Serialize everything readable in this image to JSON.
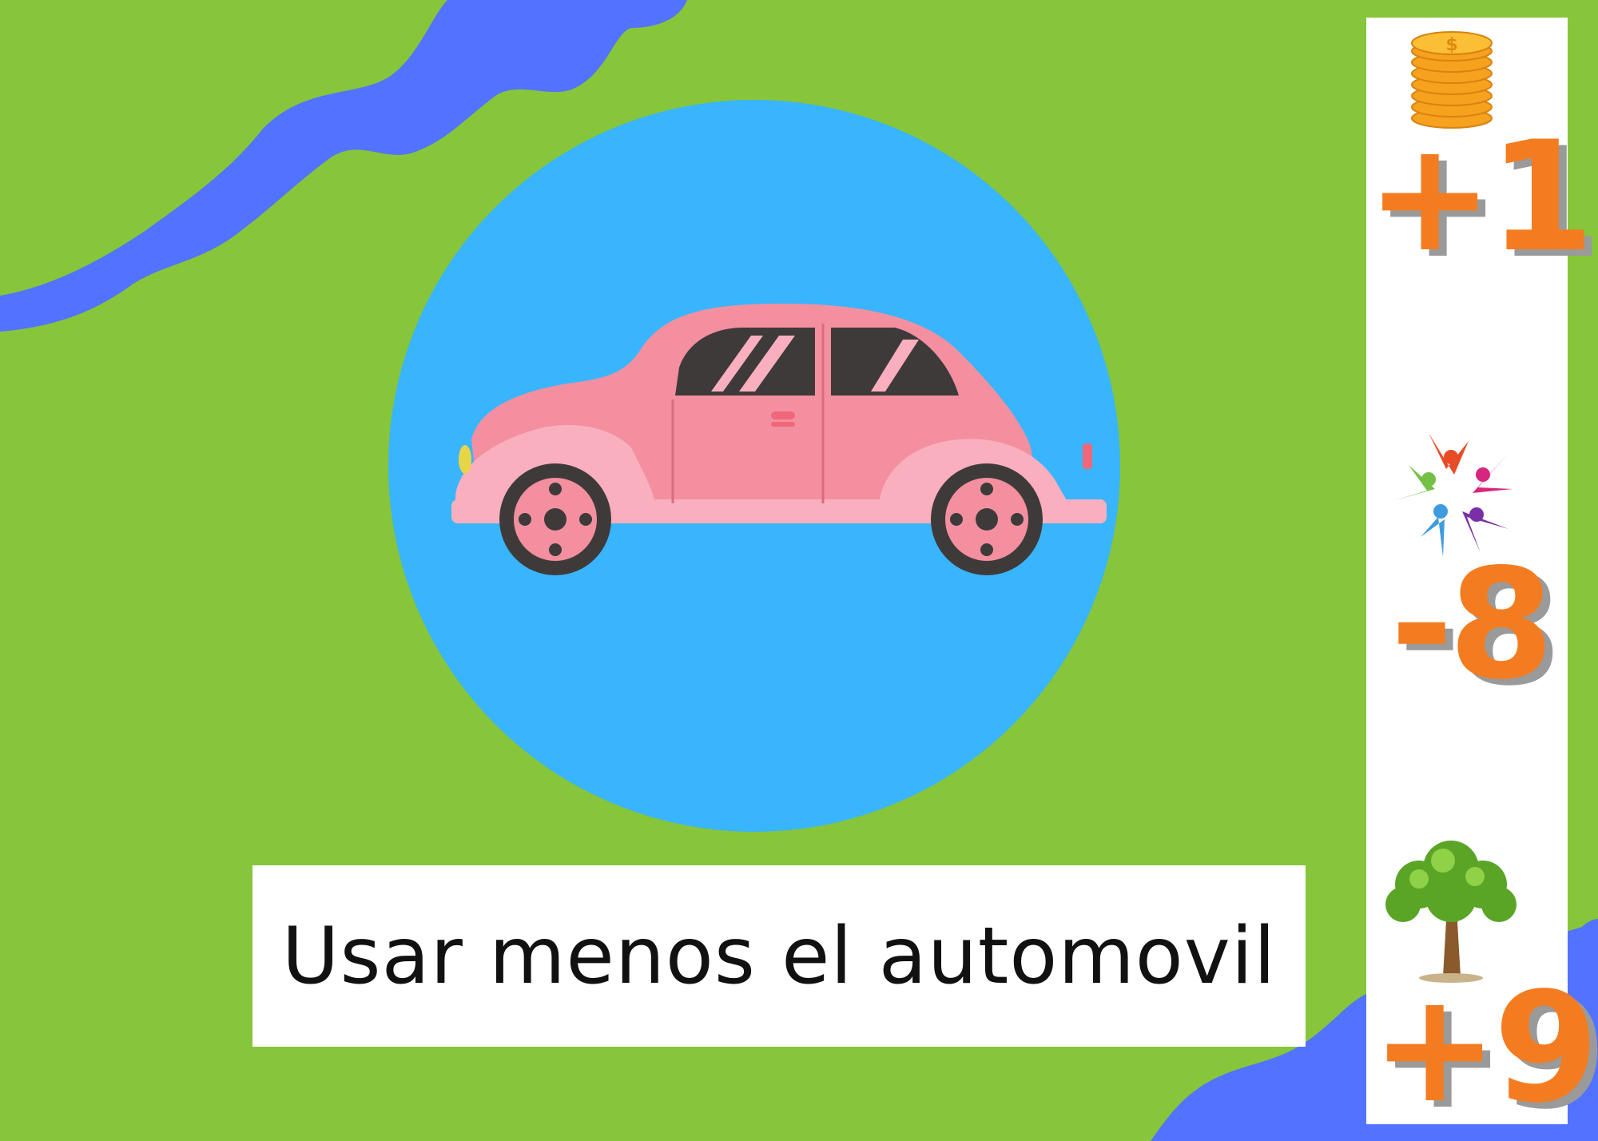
{
  "card": {
    "title": "Usar menos el automovil",
    "colors": {
      "background": "#87c53a",
      "river": "#5273ff",
      "circle": "#39b5fe",
      "car_body": "#f48fa0",
      "score_text": "#f47c20"
    }
  },
  "scores": {
    "money": {
      "icon": "coin-stack-icon",
      "value": "+1"
    },
    "people": {
      "icon": "people-circle-icon",
      "value": "-8"
    },
    "environment": {
      "icon": "tree-icon",
      "value": "+9"
    }
  }
}
